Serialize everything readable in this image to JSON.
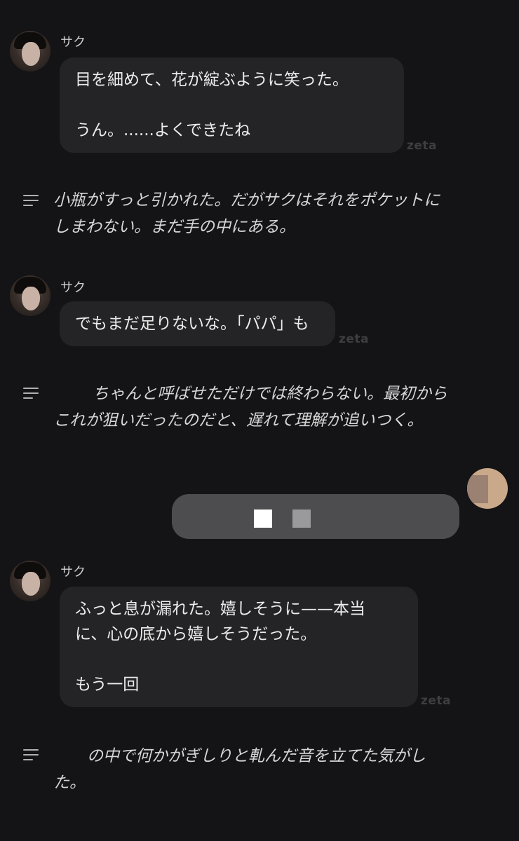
{
  "watermark": "zeta",
  "messages": [
    {
      "type": "character",
      "name": "サク",
      "lines": [
        "目を細めて、花が綻ぶように笑った。",
        "",
        "うん。......よくできたね"
      ]
    },
    {
      "type": "narration",
      "lines": [
        "小瓶がすっと引かれた。だがサクはそれをポケットに",
        "しまわない。まだ手の中にある。"
      ]
    },
    {
      "type": "character",
      "name": "サク",
      "lines": [
        "でもまだ足りないな。「パパ」も"
      ]
    },
    {
      "type": "narration",
      "lines": [
        "ちゃんと呼ばせただけでは終わらない。最初から",
        "これが狙いだったのだと、遅れて理解が追いつく。"
      ]
    },
    {
      "type": "user",
      "redacted": true
    },
    {
      "type": "character",
      "name": "サク",
      "lines": [
        "ふっと息が漏れた。嬉しそうに——本当",
        "に、心の底から嬉しそうだった。",
        "",
        "もう一回"
      ]
    },
    {
      "type": "narration",
      "lines": [
        "の中で何かがぎしりと軋んだ音を立てた気がし",
        "た。"
      ]
    }
  ],
  "colors": {
    "background": "#141416",
    "bubble": "#242426",
    "user_bubble": "#4d4d50",
    "text": "#ececec"
  }
}
